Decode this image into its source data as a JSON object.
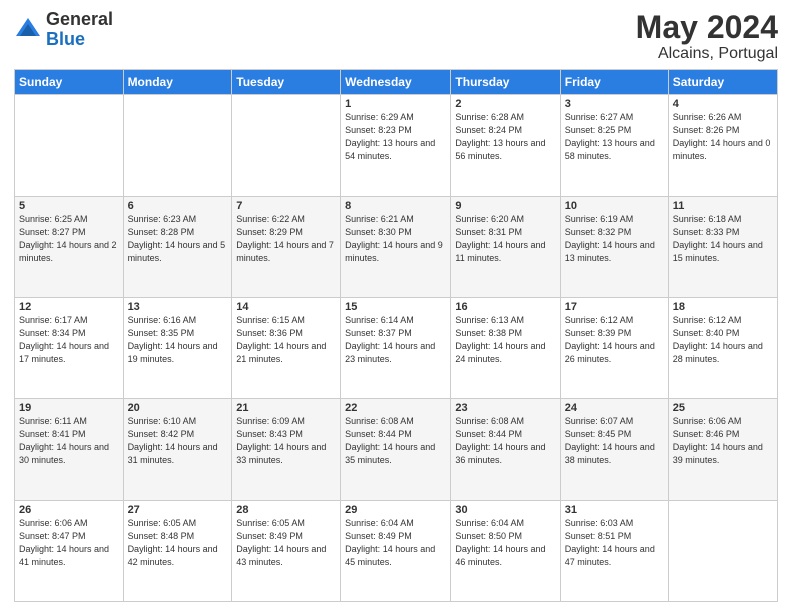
{
  "header": {
    "logo_general": "General",
    "logo_blue": "Blue",
    "title": "May 2024",
    "location": "Alcains, Portugal"
  },
  "days_of_week": [
    "Sunday",
    "Monday",
    "Tuesday",
    "Wednesday",
    "Thursday",
    "Friday",
    "Saturday"
  ],
  "weeks": [
    [
      {
        "day": "",
        "sunrise": "",
        "sunset": "",
        "daylight": ""
      },
      {
        "day": "",
        "sunrise": "",
        "sunset": "",
        "daylight": ""
      },
      {
        "day": "",
        "sunrise": "",
        "sunset": "",
        "daylight": ""
      },
      {
        "day": "1",
        "sunrise": "Sunrise: 6:29 AM",
        "sunset": "Sunset: 8:23 PM",
        "daylight": "Daylight: 13 hours and 54 minutes."
      },
      {
        "day": "2",
        "sunrise": "Sunrise: 6:28 AM",
        "sunset": "Sunset: 8:24 PM",
        "daylight": "Daylight: 13 hours and 56 minutes."
      },
      {
        "day": "3",
        "sunrise": "Sunrise: 6:27 AM",
        "sunset": "Sunset: 8:25 PM",
        "daylight": "Daylight: 13 hours and 58 minutes."
      },
      {
        "day": "4",
        "sunrise": "Sunrise: 6:26 AM",
        "sunset": "Sunset: 8:26 PM",
        "daylight": "Daylight: 14 hours and 0 minutes."
      }
    ],
    [
      {
        "day": "5",
        "sunrise": "Sunrise: 6:25 AM",
        "sunset": "Sunset: 8:27 PM",
        "daylight": "Daylight: 14 hours and 2 minutes."
      },
      {
        "day": "6",
        "sunrise": "Sunrise: 6:23 AM",
        "sunset": "Sunset: 8:28 PM",
        "daylight": "Daylight: 14 hours and 5 minutes."
      },
      {
        "day": "7",
        "sunrise": "Sunrise: 6:22 AM",
        "sunset": "Sunset: 8:29 PM",
        "daylight": "Daylight: 14 hours and 7 minutes."
      },
      {
        "day": "8",
        "sunrise": "Sunrise: 6:21 AM",
        "sunset": "Sunset: 8:30 PM",
        "daylight": "Daylight: 14 hours and 9 minutes."
      },
      {
        "day": "9",
        "sunrise": "Sunrise: 6:20 AM",
        "sunset": "Sunset: 8:31 PM",
        "daylight": "Daylight: 14 hours and 11 minutes."
      },
      {
        "day": "10",
        "sunrise": "Sunrise: 6:19 AM",
        "sunset": "Sunset: 8:32 PM",
        "daylight": "Daylight: 14 hours and 13 minutes."
      },
      {
        "day": "11",
        "sunrise": "Sunrise: 6:18 AM",
        "sunset": "Sunset: 8:33 PM",
        "daylight": "Daylight: 14 hours and 15 minutes."
      }
    ],
    [
      {
        "day": "12",
        "sunrise": "Sunrise: 6:17 AM",
        "sunset": "Sunset: 8:34 PM",
        "daylight": "Daylight: 14 hours and 17 minutes."
      },
      {
        "day": "13",
        "sunrise": "Sunrise: 6:16 AM",
        "sunset": "Sunset: 8:35 PM",
        "daylight": "Daylight: 14 hours and 19 minutes."
      },
      {
        "day": "14",
        "sunrise": "Sunrise: 6:15 AM",
        "sunset": "Sunset: 8:36 PM",
        "daylight": "Daylight: 14 hours and 21 minutes."
      },
      {
        "day": "15",
        "sunrise": "Sunrise: 6:14 AM",
        "sunset": "Sunset: 8:37 PM",
        "daylight": "Daylight: 14 hours and 23 minutes."
      },
      {
        "day": "16",
        "sunrise": "Sunrise: 6:13 AM",
        "sunset": "Sunset: 8:38 PM",
        "daylight": "Daylight: 14 hours and 24 minutes."
      },
      {
        "day": "17",
        "sunrise": "Sunrise: 6:12 AM",
        "sunset": "Sunset: 8:39 PM",
        "daylight": "Daylight: 14 hours and 26 minutes."
      },
      {
        "day": "18",
        "sunrise": "Sunrise: 6:12 AM",
        "sunset": "Sunset: 8:40 PM",
        "daylight": "Daylight: 14 hours and 28 minutes."
      }
    ],
    [
      {
        "day": "19",
        "sunrise": "Sunrise: 6:11 AM",
        "sunset": "Sunset: 8:41 PM",
        "daylight": "Daylight: 14 hours and 30 minutes."
      },
      {
        "day": "20",
        "sunrise": "Sunrise: 6:10 AM",
        "sunset": "Sunset: 8:42 PM",
        "daylight": "Daylight: 14 hours and 31 minutes."
      },
      {
        "day": "21",
        "sunrise": "Sunrise: 6:09 AM",
        "sunset": "Sunset: 8:43 PM",
        "daylight": "Daylight: 14 hours and 33 minutes."
      },
      {
        "day": "22",
        "sunrise": "Sunrise: 6:08 AM",
        "sunset": "Sunset: 8:44 PM",
        "daylight": "Daylight: 14 hours and 35 minutes."
      },
      {
        "day": "23",
        "sunrise": "Sunrise: 6:08 AM",
        "sunset": "Sunset: 8:44 PM",
        "daylight": "Daylight: 14 hours and 36 minutes."
      },
      {
        "day": "24",
        "sunrise": "Sunrise: 6:07 AM",
        "sunset": "Sunset: 8:45 PM",
        "daylight": "Daylight: 14 hours and 38 minutes."
      },
      {
        "day": "25",
        "sunrise": "Sunrise: 6:06 AM",
        "sunset": "Sunset: 8:46 PM",
        "daylight": "Daylight: 14 hours and 39 minutes."
      }
    ],
    [
      {
        "day": "26",
        "sunrise": "Sunrise: 6:06 AM",
        "sunset": "Sunset: 8:47 PM",
        "daylight": "Daylight: 14 hours and 41 minutes."
      },
      {
        "day": "27",
        "sunrise": "Sunrise: 6:05 AM",
        "sunset": "Sunset: 8:48 PM",
        "daylight": "Daylight: 14 hours and 42 minutes."
      },
      {
        "day": "28",
        "sunrise": "Sunrise: 6:05 AM",
        "sunset": "Sunset: 8:49 PM",
        "daylight": "Daylight: 14 hours and 43 minutes."
      },
      {
        "day": "29",
        "sunrise": "Sunrise: 6:04 AM",
        "sunset": "Sunset: 8:49 PM",
        "daylight": "Daylight: 14 hours and 45 minutes."
      },
      {
        "day": "30",
        "sunrise": "Sunrise: 6:04 AM",
        "sunset": "Sunset: 8:50 PM",
        "daylight": "Daylight: 14 hours and 46 minutes."
      },
      {
        "day": "31",
        "sunrise": "Sunrise: 6:03 AM",
        "sunset": "Sunset: 8:51 PM",
        "daylight": "Daylight: 14 hours and 47 minutes."
      },
      {
        "day": "",
        "sunrise": "",
        "sunset": "",
        "daylight": ""
      }
    ]
  ]
}
